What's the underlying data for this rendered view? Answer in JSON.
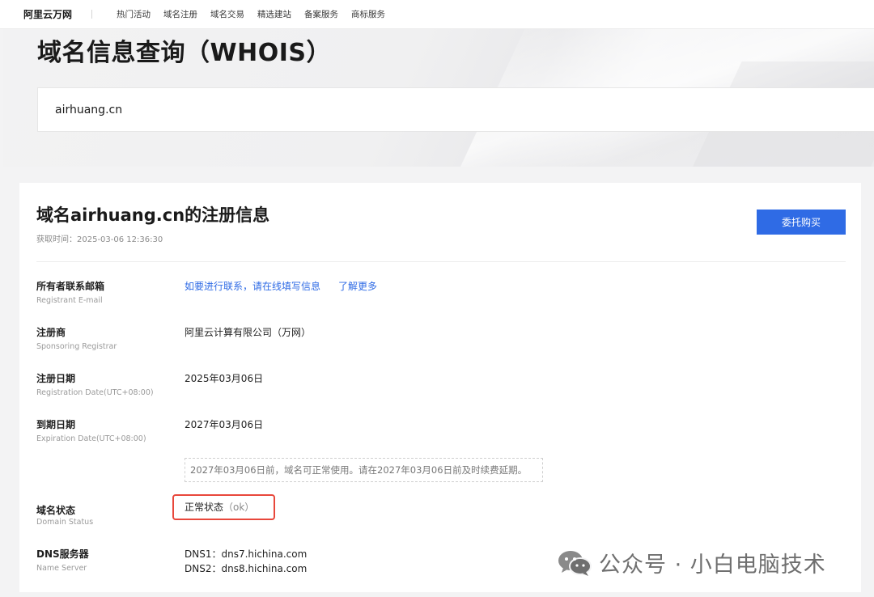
{
  "topbar": {
    "brand": "阿里云万网",
    "nav": [
      "热门活动",
      "域名注册",
      "域名交易",
      "精选建站",
      "备案服务",
      "商标服务"
    ]
  },
  "hero": {
    "title": "域名信息查询（WHOIS）",
    "search_value": "airhuang.cn"
  },
  "card": {
    "title": "域名airhuang.cn的注册信息",
    "fetch_time": "获取时间：2025-03-06 12:36:30",
    "buy_button": "委托购买"
  },
  "rows": {
    "email": {
      "label": "所有者联系邮箱",
      "sub": "Registrant E-mail",
      "link1": "如要进行联系，请在线填写信息",
      "link2": "了解更多"
    },
    "registrar": {
      "label": "注册商",
      "sub": "Sponsoring Registrar",
      "value": "阿里云计算有限公司（万网）"
    },
    "reg_date": {
      "label": "注册日期",
      "sub": "Registration Date(UTC+08:00)",
      "value": "2025年03月06日"
    },
    "exp_date": {
      "label": "到期日期",
      "sub": "Expiration Date(UTC+08:00)",
      "value": "2027年03月06日",
      "notice": "2027年03月06日前，域名可正常使用。请在2027年03月06日前及时续费延期。"
    },
    "status": {
      "label": "域名状态",
      "sub": "Domain Status",
      "value": "正常状态",
      "code": "（ok）"
    },
    "dns": {
      "label": "DNS服务器",
      "sub": "Name Server",
      "dns1": "DNS1：dns7.hichina.com",
      "dns2": "DNS2：dns8.hichina.com"
    }
  },
  "watermark": "公众号 · 小白电脑技术",
  "icons": {
    "watermark_icon": "wechat-icon"
  },
  "colors": {
    "primary": "#2f6be5",
    "highlight": "#e8473b"
  }
}
